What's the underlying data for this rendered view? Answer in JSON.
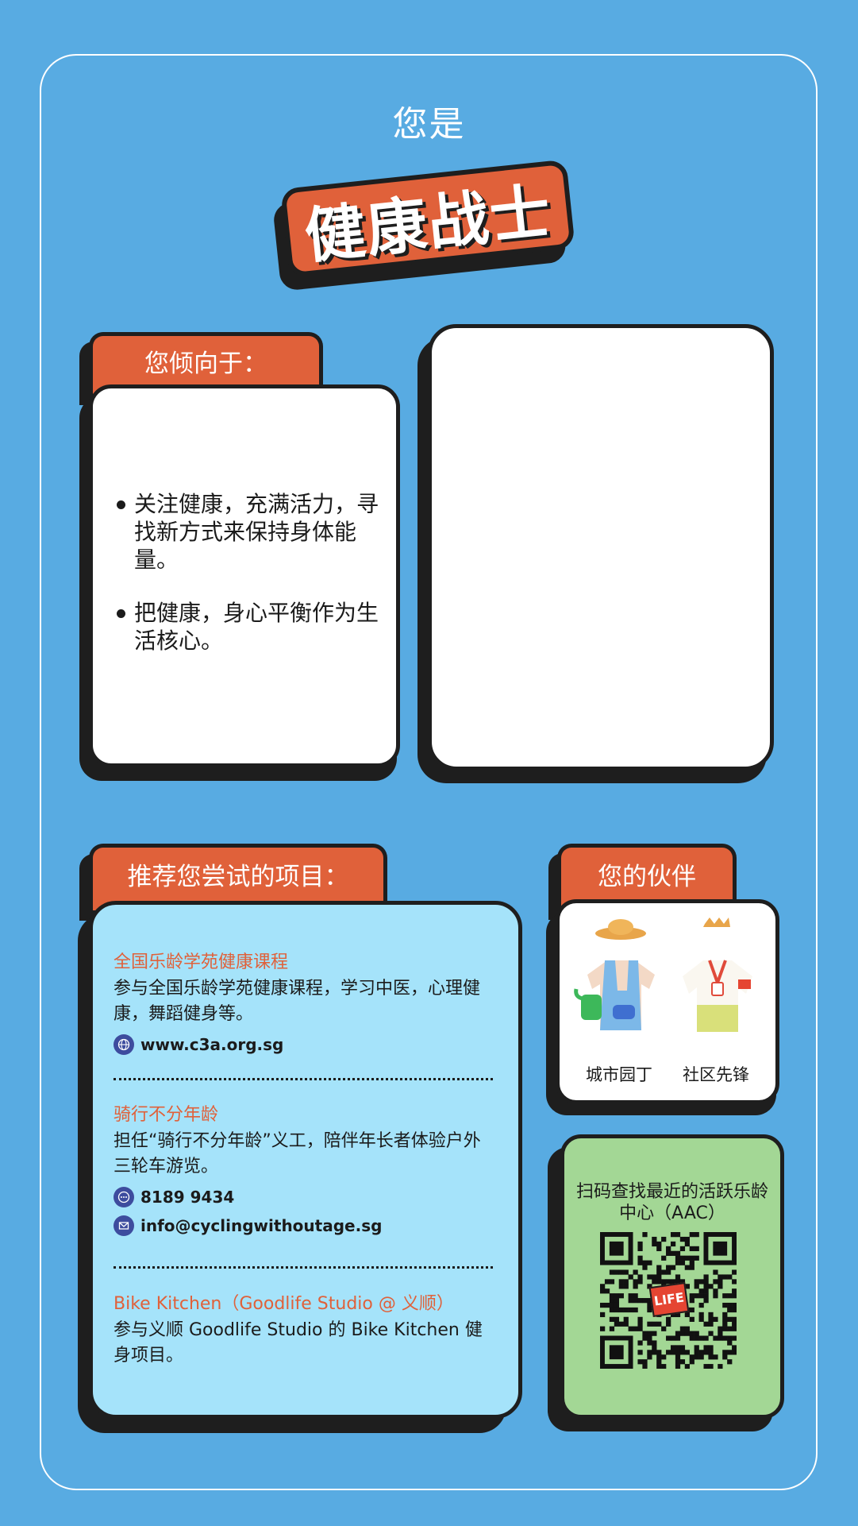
{
  "header": {
    "subtitle": "您是",
    "title": "健康战士"
  },
  "traits": {
    "tab": "您倾向于：",
    "items": [
      "关注健康，充满活力，寻找新方式来保持身体能量。",
      "把健康，身心平衡作为生活核心。"
    ]
  },
  "recommend": {
    "tab": "推荐您尝试的项目：",
    "programs": [
      {
        "title": "全国乐龄学苑健康课程",
        "desc": "参与全国乐龄学苑健康课程，学习中医，心理健康，舞蹈健身等。",
        "contacts": [
          {
            "icon": "globe-icon",
            "text": "www.c3a.org.sg"
          }
        ]
      },
      {
        "title": "骑行不分年龄",
        "desc": "担任“骑行不分年龄”义工，陪伴年长者体验户外三轮车游览。",
        "contacts": [
          {
            "icon": "phone-chat-icon",
            "text": "8189 9434"
          },
          {
            "icon": "mail-icon",
            "text": "info@cyclingwithoutage.sg"
          }
        ]
      },
      {
        "title": "Bike Kitchen（Goodlife Studio @ 义顺）",
        "desc": "参与义顺 Goodlife Studio 的 Bike Kitchen 健身项目。",
        "contacts": []
      }
    ]
  },
  "partners": {
    "tab": "您的伙伴",
    "items": [
      {
        "label": "城市园丁",
        "icon": "gardener-outfit-icon"
      },
      {
        "label": "社区先锋",
        "icon": "volunteer-outfit-icon"
      }
    ]
  },
  "scan": {
    "text": "扫码查找最近的活跃乐龄中心（AAC）",
    "qr_logo": "LIFE"
  },
  "colors": {
    "background": "#58ABE2",
    "accent": "#E0613A",
    "program_card": "#A5E3FA",
    "scan_card": "#A3D795"
  }
}
